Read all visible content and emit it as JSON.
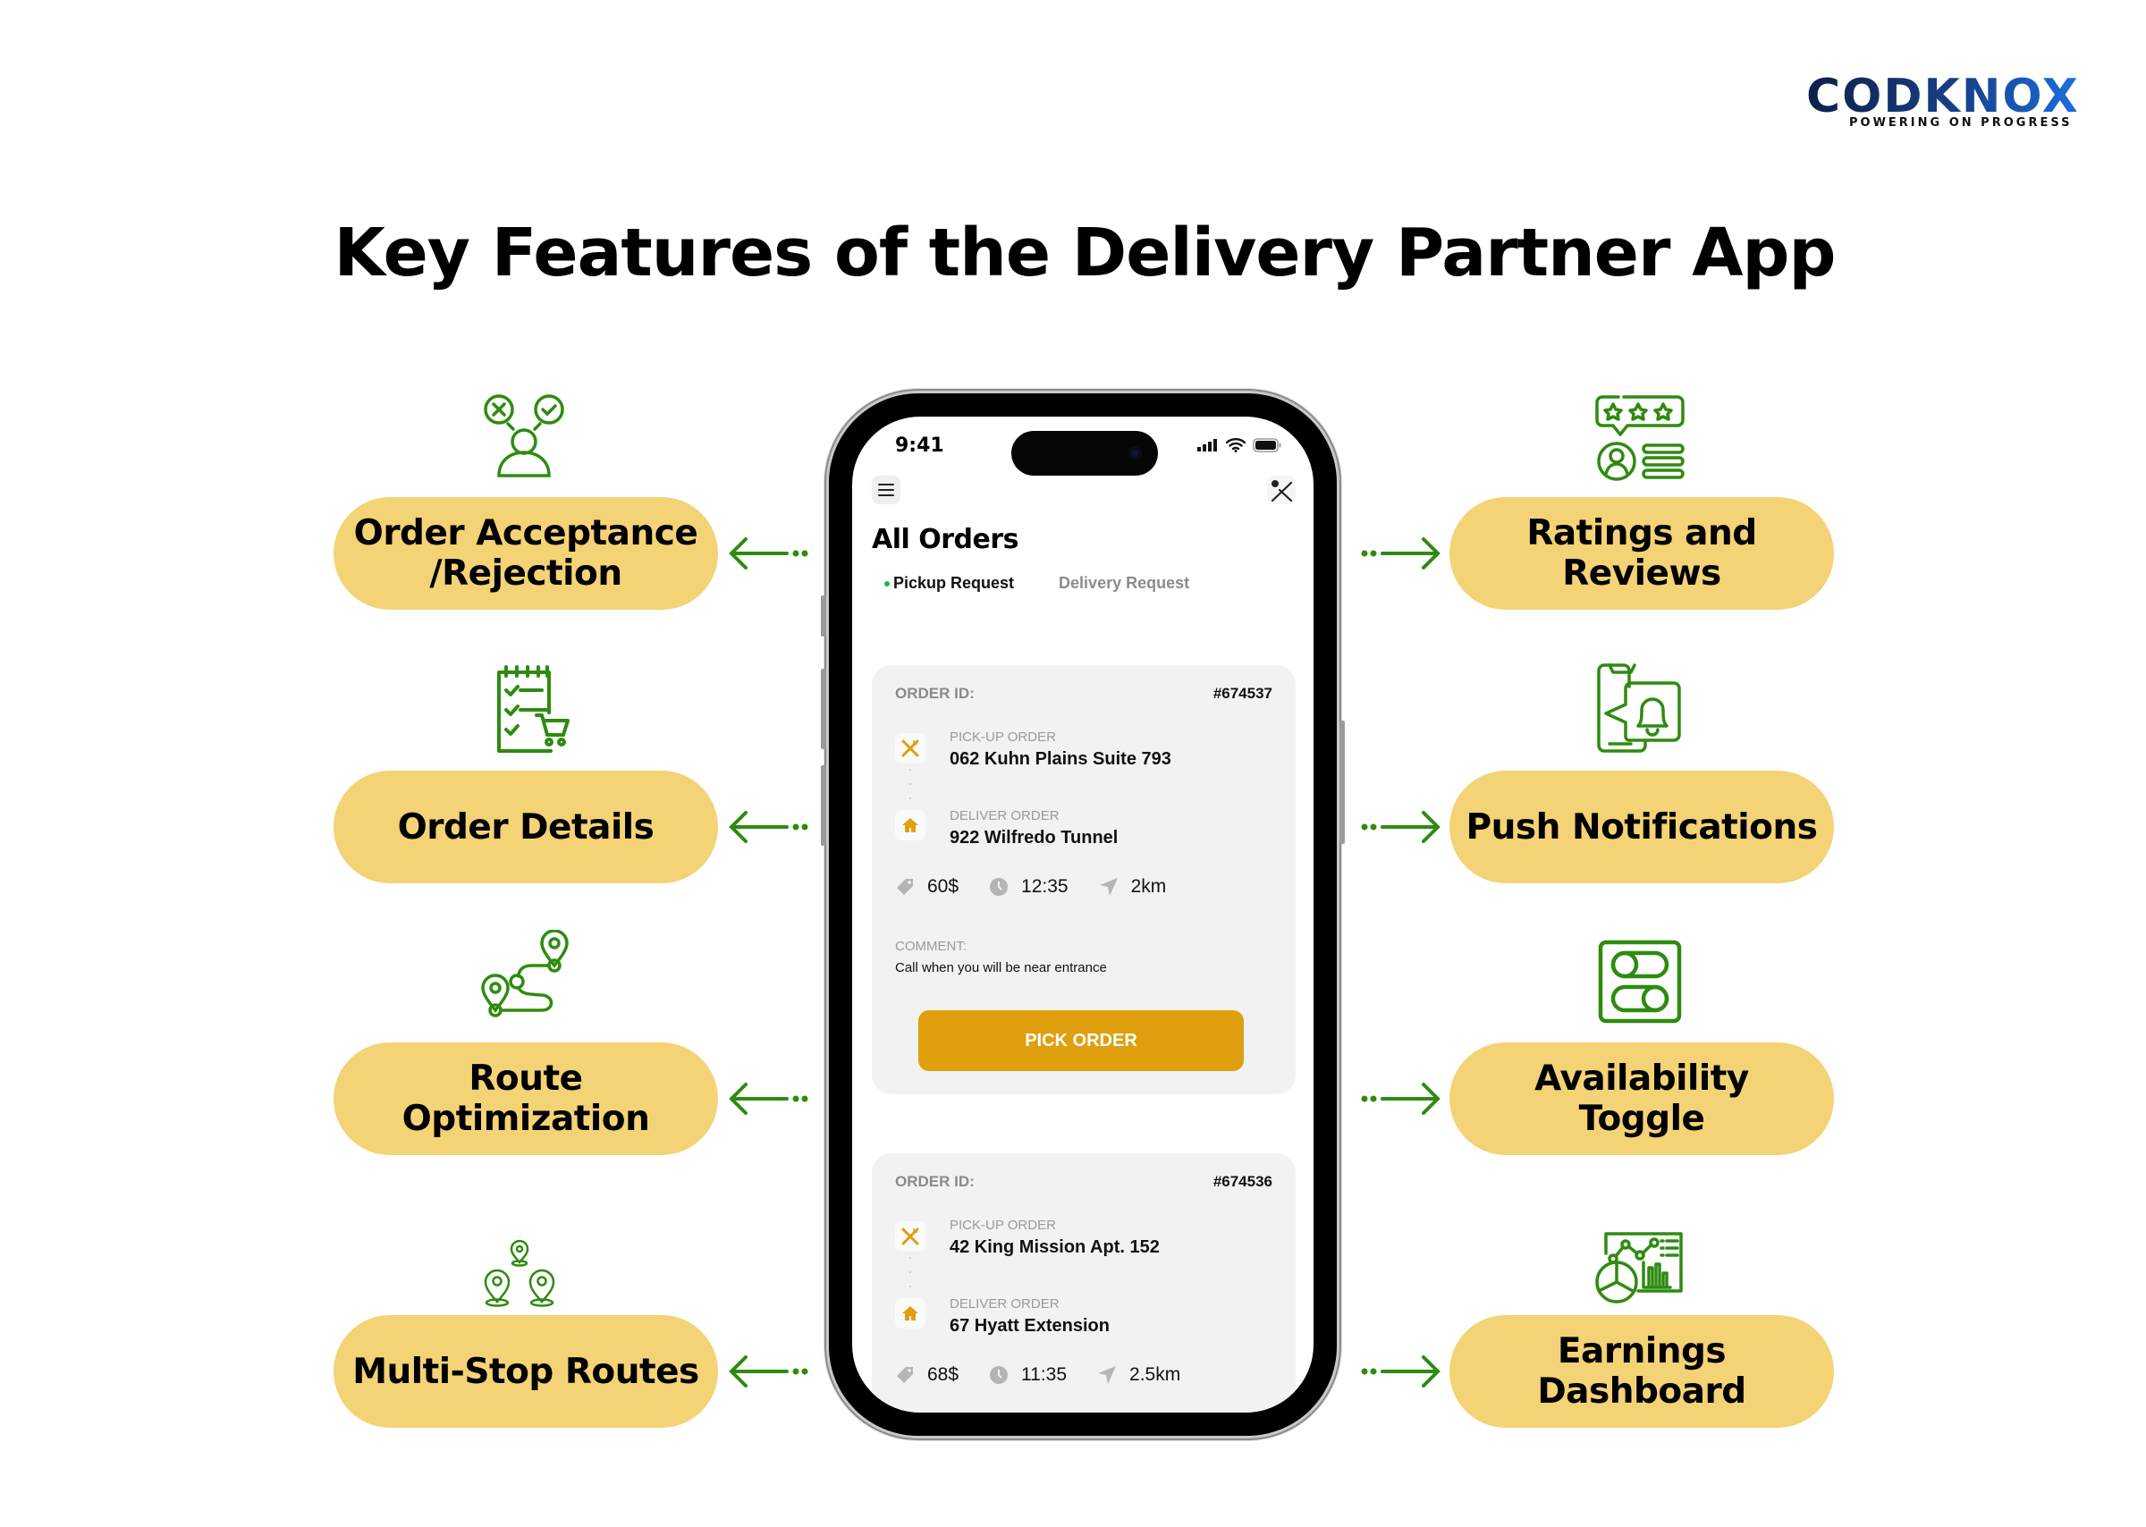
{
  "brand": {
    "name": "CODKNOX",
    "tagline": "POWERING ON PROGRESS",
    "colors": {
      "dark": "#0d2147",
      "light": "#1a6ee0"
    }
  },
  "title": "Key Features of the Delivery Partner App",
  "colors": {
    "pill": "#f4d376",
    "icon_green": "#2e8b10",
    "accent": "#df9f0e"
  },
  "features_left": [
    {
      "label": "Order Acceptance /Rejection",
      "line1": "Order Acceptance",
      "line2": "/Rejection",
      "icon": "person-accept-reject-icon"
    },
    {
      "label": "Order Details",
      "icon": "checklist-cart-icon"
    },
    {
      "label": "Route Optimization",
      "line1": "Route",
      "line2": "Optimization",
      "icon": "route-pins-icon"
    },
    {
      "label": "Multi-Stop Routes",
      "icon": "multi-pins-icon"
    }
  ],
  "features_right": [
    {
      "label": "Ratings and Reviews",
      "icon": "star-review-icon"
    },
    {
      "label": "Push Notifications",
      "icon": "phone-bell-icon"
    },
    {
      "label": "Availability Toggle",
      "line1": "Availability",
      "line2": "Toggle",
      "icon": "toggle-switches-icon"
    },
    {
      "label": "Earnings Dashboard",
      "icon": "dashboard-chart-icon"
    }
  ],
  "phone": {
    "status_time": "9:41",
    "screen_title": "All Orders",
    "tabs": [
      {
        "label": "Pickup Request",
        "active": true
      },
      {
        "label": "Delivery Request",
        "active": false
      }
    ],
    "orders": [
      {
        "id_label": "ORDER ID:",
        "id": "#674537",
        "pickup_label": "PICK-UP ORDER",
        "pickup": "062 Kuhn Plains Suite 793",
        "deliver_label": "DELIVER ORDER",
        "deliver": "922 Wilfredo Tunnel",
        "price": "60$",
        "time": "12:35",
        "distance": "2km",
        "comment_label": "COMMENT:",
        "comment": "Call when you will be near entrance",
        "button": "PICK ORDER"
      },
      {
        "id_label": "ORDER ID:",
        "id": "#674536",
        "pickup_label": "PICK-UP ORDER",
        "pickup": "42 King Mission Apt. 152",
        "deliver_label": "DELIVER ORDER",
        "deliver": "67 Hyatt Extension",
        "price": "68$",
        "time": "11:35",
        "distance": "2.5km"
      }
    ]
  }
}
